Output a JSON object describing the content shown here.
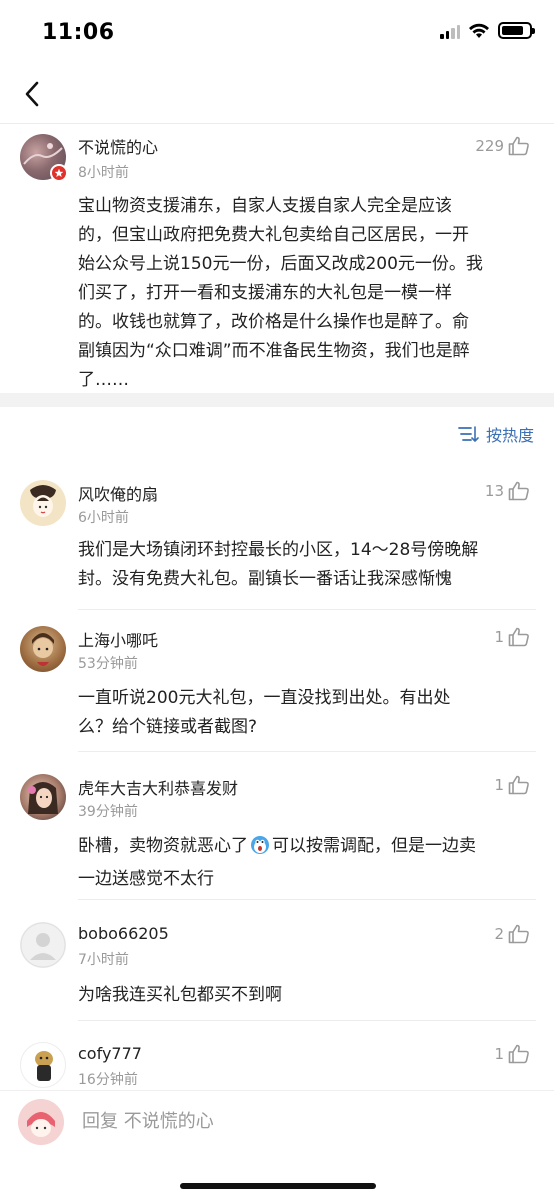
{
  "status_bar": {
    "time": "11:06",
    "signal_icon": "cellular-signal-icon",
    "wifi_icon": "wifi-icon",
    "battery_icon": "battery-icon",
    "battery_level": 0.8
  },
  "nav": {
    "back_icon": "chevron-left-icon"
  },
  "main_comment": {
    "author": "不说慌的心",
    "time": "8小时前",
    "likes": "229",
    "text_lines": [
      "宝山物资支援浦东，自家人支援自家人完全是应该",
      "的，但宝山政府把免费大礼包卖给自己区居民，一开",
      "始公众号上说150元一份，后面又改成200元一份。我",
      "们买了，打开一看和支援浦东的大礼包是一模一样",
      "的。收钱也就算了，改价格是什么操作也是醉了。俞",
      "副镇因为“众口难调”而不准备民生物资，我们也是醉",
      "了……"
    ]
  },
  "sort": {
    "label": "按热度",
    "icon": "sort-icon"
  },
  "replies": [
    {
      "author": "风吹俺的扇",
      "time": "6小时前",
      "likes": "13",
      "text_lines": [
        "我们是大场镇闭环封控最长的小区，14～28号傍晚解",
        "封。没有免费大礼包。副镇长一番话让我深感惭愧"
      ]
    },
    {
      "author": "上海小哪吒",
      "time": "53分钟前",
      "likes": "1",
      "text_lines": [
        "一直听说200元大礼包，一直没找到出处。有出处",
        "么？给个链接或者截图?"
      ]
    },
    {
      "author": "虎年大吉大利恭喜发财",
      "time": "39分钟前",
      "likes": "1",
      "text_lines": [
        "卧槽，卖物资就恶心了",
        "可以按需调配，但是一边卖",
        "一边送感觉不太行"
      ]
    },
    {
      "author": "bobo66205",
      "time": "7小时前",
      "likes": "2",
      "text_lines": [
        "为啥我连买礼包都买不到啊"
      ]
    },
    {
      "author": "cofy777",
      "time": "16分钟前",
      "likes": "1",
      "text_lines": []
    }
  ],
  "reply_bar": {
    "placeholder": "回复 不说慌的心"
  }
}
